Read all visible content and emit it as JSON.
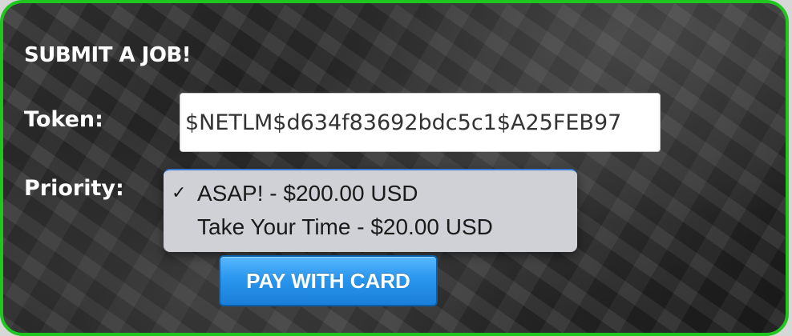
{
  "form": {
    "title": "SUBMIT A JOB!",
    "token_label": "Token:",
    "token_value": "$NETLM$d634f83692bdc5c1$A25FEB97",
    "priority_label": "Priority:",
    "priority_options": [
      {
        "label": "ASAP! - $200.00 USD",
        "selected": true
      },
      {
        "label": "Take Your Time - $20.00 USD",
        "selected": false
      }
    ],
    "pay_button_label": "PAY WITH CARD"
  },
  "colors": {
    "border": "#1ec61e",
    "button": "#2a96ee",
    "dropdown_bg": "#cfd1d6"
  },
  "icons": {
    "selected_marker": "checkmark-icon"
  }
}
